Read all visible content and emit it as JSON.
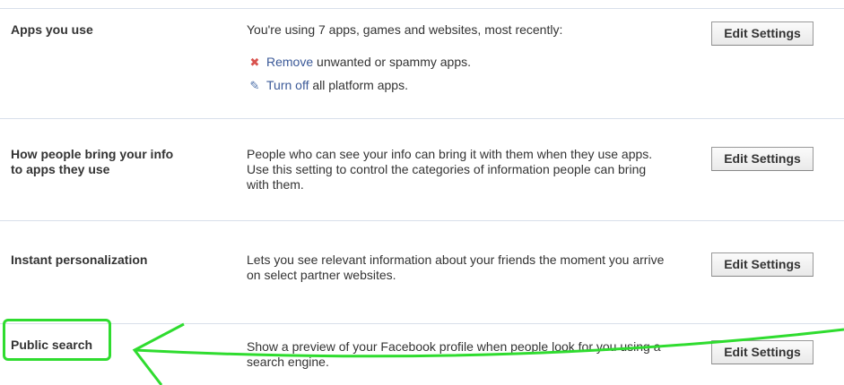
{
  "rows": [
    {
      "label": "Apps you use",
      "description": "You're using 7 apps, games and websites, most recently:",
      "links": [
        {
          "icon": "remove-icon",
          "link_text": "Remove",
          "rest": " unwanted or spammy apps."
        },
        {
          "icon": "pencil-icon",
          "link_text": "Turn off",
          "rest": " all platform apps."
        }
      ],
      "button": "Edit Settings"
    },
    {
      "label": "How people bring your info\nto apps they use",
      "description": "People who can see your info can bring it with them when they use apps. Use this setting to control the categories of information people can bring with them.",
      "button": "Edit Settings"
    },
    {
      "label": "Instant personalization",
      "description": "Lets you see relevant information about your friends the moment you arrive on select partner websites.",
      "button": "Edit Settings"
    },
    {
      "label": "Public search",
      "description": "Show a preview of your Facebook profile when people look for you using a search engine.",
      "button": "Edit Settings"
    }
  ],
  "annotation": {
    "color": "#2fdc2f",
    "highlight": "Public search"
  },
  "colors": {
    "link": "#3b5998",
    "divider": "#d8dfea",
    "text": "#333333"
  }
}
